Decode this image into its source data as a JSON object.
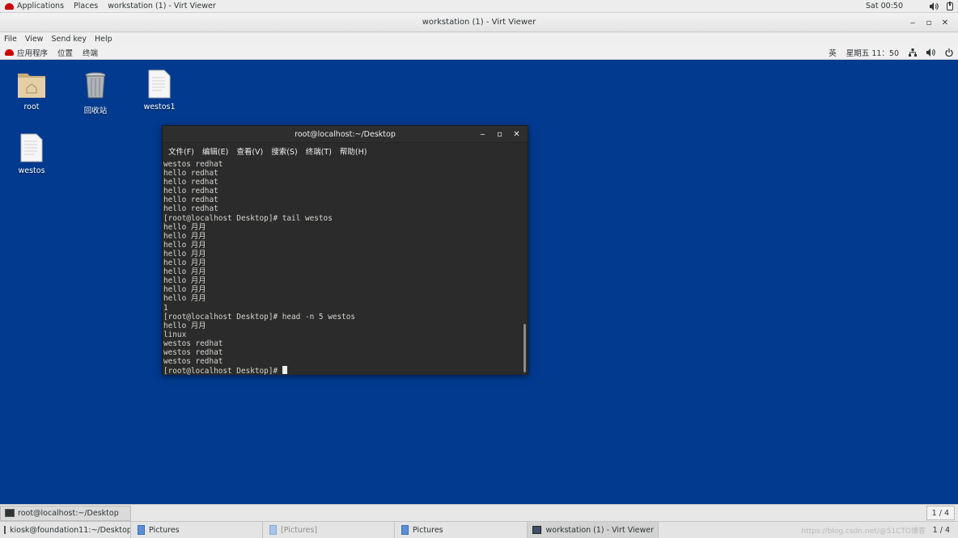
{
  "host_topbar": {
    "applications": "Applications",
    "places": "Places",
    "active_window": "workstation (1) - Virt Viewer",
    "clock": "Sat 00:50",
    "icons": [
      "volume-icon",
      "power-icon"
    ]
  },
  "viewer": {
    "title": "workstation (1) - Virt Viewer",
    "menu": [
      "File",
      "View",
      "Send key",
      "Help"
    ]
  },
  "guest_topbar": {
    "apps": "应用程序",
    "places": "位置",
    "terminal": "终端",
    "input_method": "英",
    "clock": "星期五 11：50",
    "icons": [
      "network-icon",
      "volume-icon",
      "power-icon"
    ]
  },
  "desktop_icons": [
    {
      "label": "root",
      "icon": "home-folder-icon"
    },
    {
      "label": "回收站",
      "icon": "trash-icon"
    },
    {
      "label": "westos1",
      "icon": "text-file-icon"
    },
    {
      "label": "westos",
      "icon": "text-file-icon"
    }
  ],
  "terminal": {
    "title": "root@localhost:~/Desktop",
    "menu": [
      "文件(F)",
      "编辑(E)",
      "查看(V)",
      "搜索(S)",
      "终端(T)",
      "帮助(H)"
    ],
    "lines": [
      "westos redhat",
      "hello redhat",
      "hello redhat",
      "hello redhat",
      "hello redhat",
      "hello redhat",
      "[root@localhost Desktop]# tail westos",
      "hello 月月",
      "hello 月月",
      "hello 月月",
      "hello 月月",
      "hello 月月",
      "hello 月月",
      "hello 月月",
      "hello 月月",
      "hello 月月",
      "1",
      "[root@localhost Desktop]# head -n 5 westos",
      "hello 月月",
      "linux",
      "westos redhat",
      "westos redhat",
      "westos redhat"
    ],
    "prompt": "[root@localhost Desktop]# "
  },
  "guest_taskbar": {
    "tasks": [
      "root@localhost:~/Desktop"
    ],
    "pager": "1 / 4"
  },
  "host_taskbar": {
    "tasks": [
      "kiosk@foundation11:~/Desktop",
      "Pictures",
      "[Pictures]",
      "Pictures",
      "workstation (1) - Virt Viewer"
    ],
    "pager": "1 / 4",
    "watermark": "https://blog.csdn.net/@51CTO博客"
  }
}
